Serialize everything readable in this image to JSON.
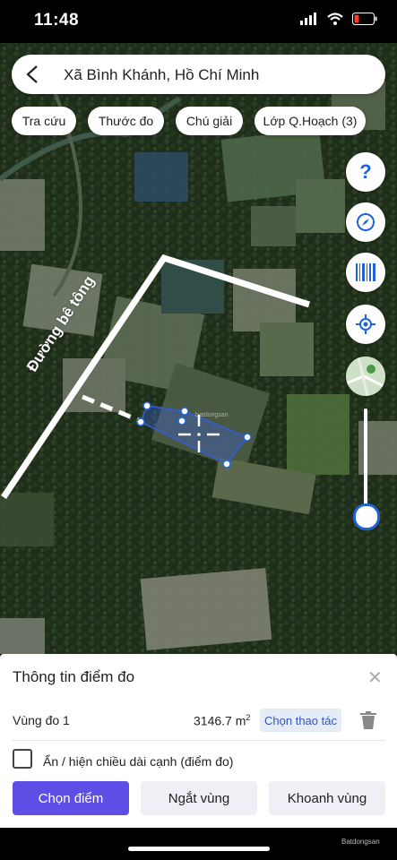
{
  "status": {
    "time": "11:48"
  },
  "search": {
    "location": "Xã Bình Khánh, Hồ Chí Minh"
  },
  "chips": [
    "Tra cứu",
    "Thước đo",
    "Chú giải",
    "Lớp Q.Hoạch (3)"
  ],
  "map": {
    "road_label": "Đường bê tông",
    "watermark": "batdongsan"
  },
  "panel": {
    "title": "Thông tin điểm đo",
    "zone_label": "Vùng đo 1",
    "area_value": "3146.7 m",
    "area_unit_exp": "2",
    "choose_action": "Chọn thao tác",
    "toggle_label": "Ẩn / hiện chiều dài cạnh (điểm đo)",
    "buttons": {
      "choose_point": "Chọn điểm",
      "break_zone": "Ngắt vùng",
      "drill_zone": "Khoanh vùng"
    }
  },
  "footer": {
    "watermark": "Batdongsan"
  },
  "colors": {
    "primary": "#5d4ee6",
    "accent_blue": "#1e64d6",
    "polygon": "#2f5fe0"
  }
}
